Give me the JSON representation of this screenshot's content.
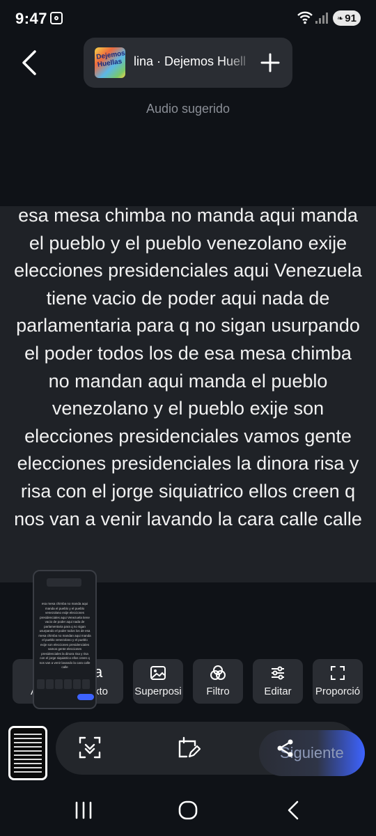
{
  "status": {
    "time": "9:47",
    "battery": "91"
  },
  "header": {
    "audio_title": "lina · Dejemos Huell",
    "album_art_text": "Dejemos Huellas",
    "suggested_label": "Audio sugerido"
  },
  "canvas": {
    "lyric_text": "esa mesa chimba no manda aqui manda el pueblo y el pueblo venezolano exije elecciones presidenciales aqui Venezuela tiene vacio de poder aqui nada de parlamentaria para q no sigan usurpando el poder todos los de esa mesa chimba no mandan aqui manda el pueblo venezolano y el pueblo exije son elecciones presidenciales vamos gente elecciones presidenciales la dinora risa y risa con el jorge siquiatrico ellos creen q nos van a venir lavando la cara calle calle"
  },
  "toolbar": {
    "items": [
      {
        "label": "A",
        "icon": "audio-icon"
      },
      {
        "label": "xto",
        "icon": "text-icon"
      },
      {
        "label": "Superposi",
        "icon": "image-overlay-icon"
      },
      {
        "label": "Filtro",
        "icon": "filter-icon"
      },
      {
        "label": "Editar",
        "icon": "sliders-icon"
      },
      {
        "label": "Proporció",
        "icon": "aspect-ratio-icon"
      }
    ]
  },
  "thumbnail_preview": {
    "mini_text": "esa mesa chimba no manda aqui manda el pueblo y el pueblo venezolano exije elecciones presidenciales aqui Venezuela tiene vacio de poder aqui nada de parlamentaria para q no sigan usurpando el poder todos los de esa mesa chimba no mandan aqui manda el pueblo venezolano y el pueblo exije son elecciones presidenciales vamos gente elecciones presidenciales la dinora risa y risa con el jorge siquiatrico ellos creen q nos van a venir lavando la cara calle calle"
  },
  "bottom": {
    "next_label": "Siguiente"
  },
  "colors": {
    "background": "#0f1217",
    "canvas": "#1f2227",
    "chip": "#2a2d33",
    "accent": "#3d63ff"
  }
}
